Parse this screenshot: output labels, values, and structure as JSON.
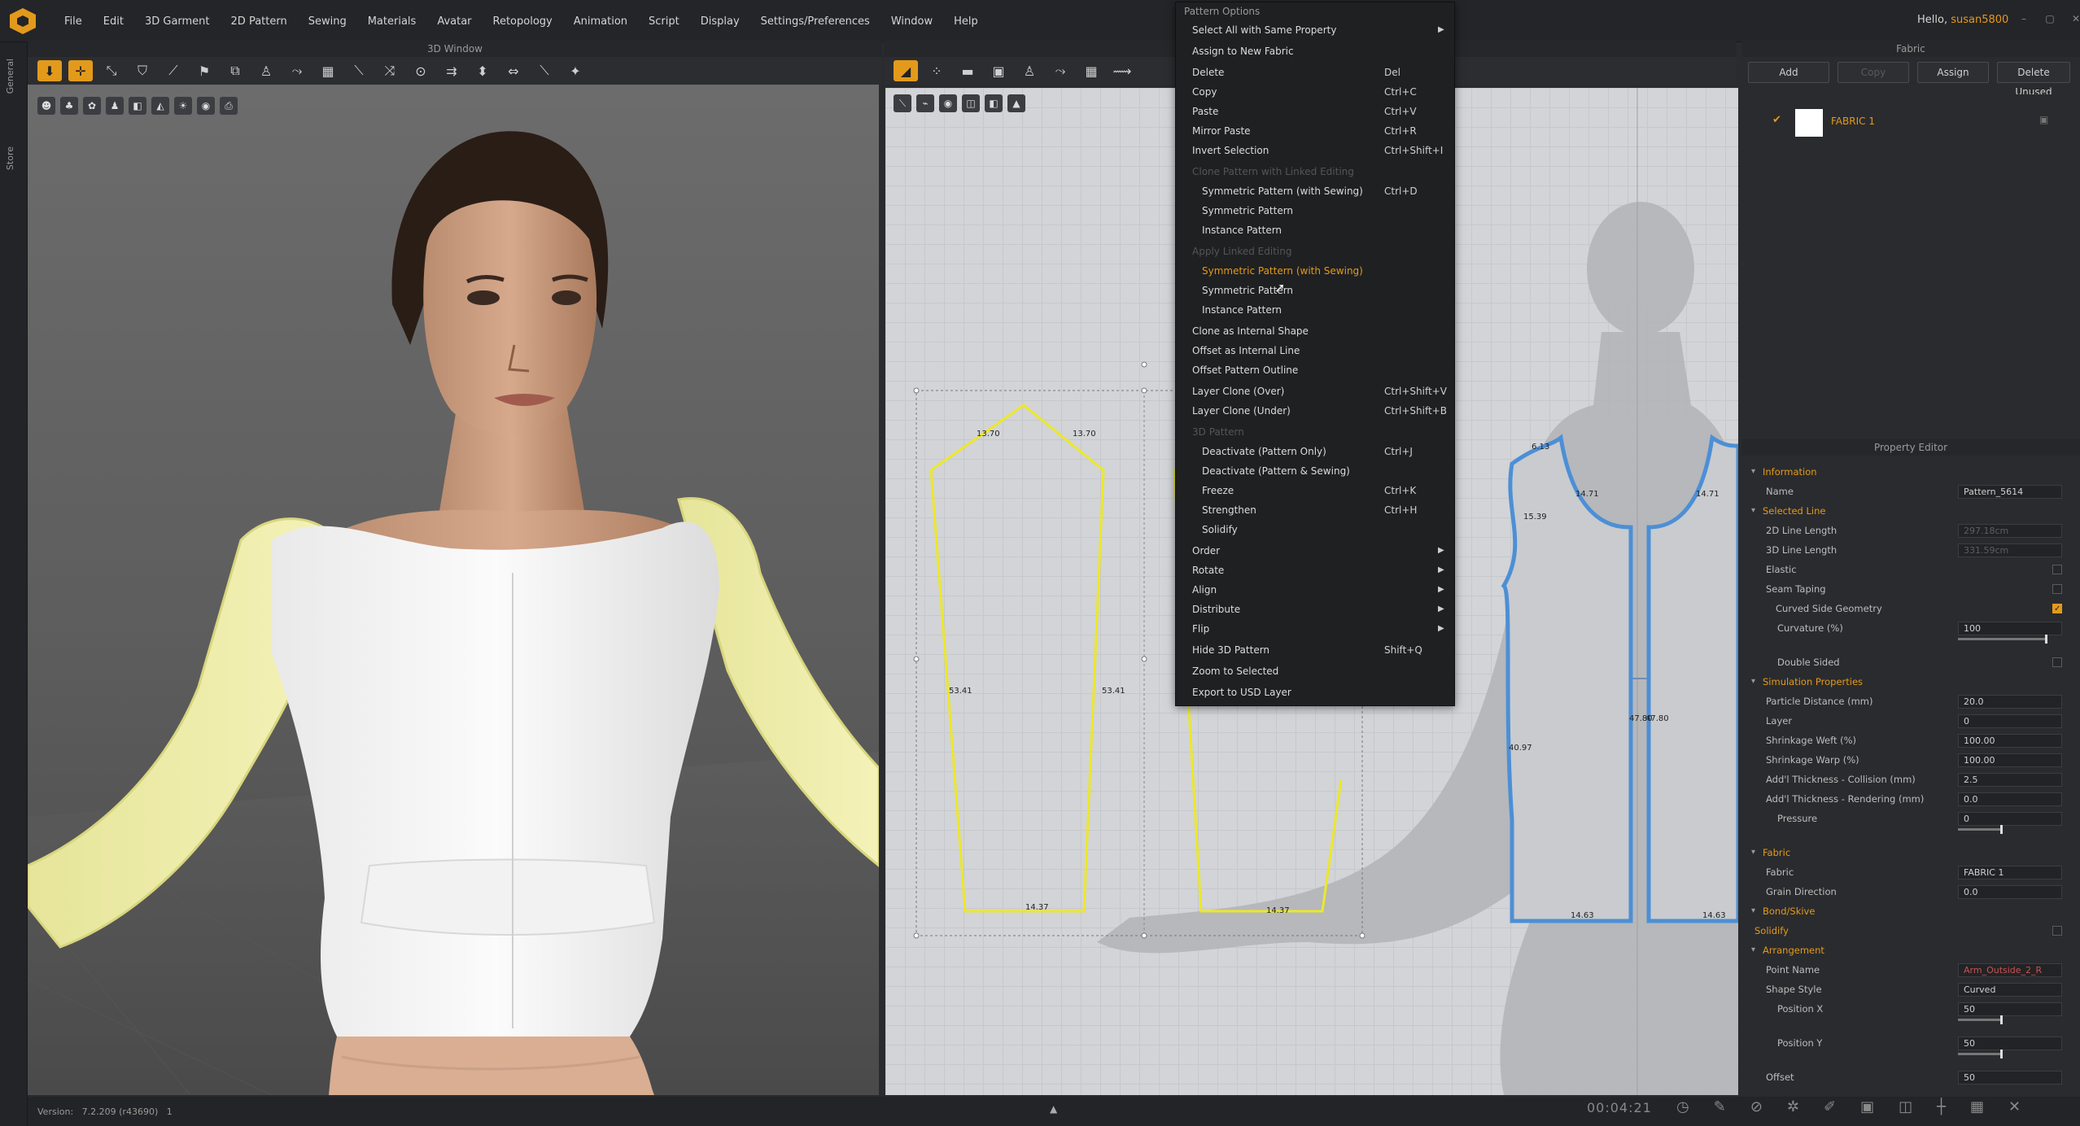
{
  "menubar": {
    "items": [
      "File",
      "Edit",
      "3D Garment",
      "2D Pattern",
      "Sewing",
      "Materials",
      "Avatar",
      "Retopology",
      "Animation",
      "Script",
      "Display",
      "Settings/Preferences",
      "Window",
      "Help"
    ],
    "greeting": "Hello,",
    "username": "susan5800"
  },
  "left_tabs": [
    "General",
    "Store"
  ],
  "window3d": {
    "title": "3D Window"
  },
  "fabric_panel": {
    "title": "Fabric",
    "buttons": {
      "add": "Add",
      "copy": "Copy",
      "assign": "Assign",
      "delete_unused": "Delete Unused"
    },
    "item": {
      "name": "FABRIC 1"
    }
  },
  "context_menu": {
    "title": "Pattern Options",
    "items": [
      {
        "label": "Select All with Same Property",
        "key": "",
        "submenu": true,
        "kind": "item"
      },
      {
        "label": "Assign to New Fabric",
        "key": "",
        "submenu": false,
        "kind": "item"
      },
      {
        "label": "Delete",
        "key": "Del",
        "submenu": false,
        "kind": "item"
      },
      {
        "label": "Copy",
        "key": "Ctrl+C",
        "submenu": false,
        "kind": "item"
      },
      {
        "label": "Paste",
        "key": "Ctrl+V",
        "submenu": false,
        "kind": "item"
      },
      {
        "label": "Mirror Paste",
        "key": "Ctrl+R",
        "submenu": false,
        "kind": "item"
      },
      {
        "label": "Invert Selection",
        "key": "Ctrl+Shift+I",
        "submenu": false,
        "kind": "item"
      },
      {
        "label": "Clone Pattern with Linked Editing",
        "key": "",
        "submenu": false,
        "kind": "header"
      },
      {
        "label": "Symmetric Pattern (with Sewing)",
        "key": "Ctrl+D",
        "submenu": false,
        "kind": "indent"
      },
      {
        "label": "Symmetric Pattern",
        "key": "",
        "submenu": false,
        "kind": "indent"
      },
      {
        "label": "Instance Pattern",
        "key": "",
        "submenu": false,
        "kind": "indent"
      },
      {
        "label": "Apply Linked Editing",
        "key": "",
        "submenu": false,
        "kind": "header"
      },
      {
        "label": "Symmetric Pattern (with Sewing)",
        "key": "",
        "submenu": false,
        "kind": "highlight"
      },
      {
        "label": "Symmetric Pattern",
        "key": "",
        "submenu": false,
        "kind": "indent"
      },
      {
        "label": "Instance Pattern",
        "key": "",
        "submenu": false,
        "kind": "indent"
      },
      {
        "label": "Clone as Internal Shape",
        "key": "",
        "submenu": false,
        "kind": "item"
      },
      {
        "label": "Offset as Internal Line",
        "key": "",
        "submenu": false,
        "kind": "item"
      },
      {
        "label": "Offset Pattern Outline",
        "key": "",
        "submenu": false,
        "kind": "item"
      },
      {
        "label": "Layer Clone (Over)",
        "key": "Ctrl+Shift+V",
        "submenu": false,
        "kind": "item"
      },
      {
        "label": "Layer Clone (Under)",
        "key": "Ctrl+Shift+B",
        "submenu": false,
        "kind": "item"
      },
      {
        "label": "3D Pattern",
        "key": "",
        "submenu": false,
        "kind": "header"
      },
      {
        "label": "Deactivate (Pattern Only)",
        "key": "Ctrl+J",
        "submenu": false,
        "kind": "indent"
      },
      {
        "label": "Deactivate (Pattern & Sewing)",
        "key": "",
        "submenu": false,
        "kind": "indent"
      },
      {
        "label": "Freeze",
        "key": "Ctrl+K",
        "submenu": false,
        "kind": "indent"
      },
      {
        "label": "Strengthen",
        "key": "Ctrl+H",
        "submenu": false,
        "kind": "indent"
      },
      {
        "label": "Solidify",
        "key": "",
        "submenu": false,
        "kind": "indent"
      },
      {
        "label": "Order",
        "key": "",
        "submenu": true,
        "kind": "item"
      },
      {
        "label": "Rotate",
        "key": "",
        "submenu": true,
        "kind": "item"
      },
      {
        "label": "Align",
        "key": "",
        "submenu": true,
        "kind": "item"
      },
      {
        "label": "Distribute",
        "key": "",
        "submenu": true,
        "kind": "item"
      },
      {
        "label": "Flip",
        "key": "",
        "submenu": true,
        "kind": "item"
      },
      {
        "label": "Hide 3D Pattern",
        "key": "Shift+Q",
        "submenu": false,
        "kind": "item"
      },
      {
        "label": "Zoom to Selected",
        "key": "",
        "submenu": false,
        "kind": "item"
      },
      {
        "label": "Export to USD Layer",
        "key": "",
        "submenu": false,
        "kind": "item"
      }
    ]
  },
  "pattern_measurements": {
    "left_top_a": "13.70",
    "left_top_b": "13.70",
    "left_side_a": "53.41",
    "left_side_b": "53.41",
    "left_bottom": "14.37",
    "mid_bottom": "14.37",
    "bodice_neck": "6.13",
    "bodice_shoulder_a": "14.71",
    "bodice_shoulder_b": "14.71",
    "bodice_armhole": "15.39",
    "bodice_side": "40.97",
    "bodice_center": "47.80",
    "bodice_center_b": "47.80",
    "bodice_hem_a": "14.63",
    "bodice_hem_b": "14.63"
  },
  "property_editor": {
    "title": "Property Editor",
    "rows": [
      {
        "type": "sec",
        "label": "Information"
      },
      {
        "type": "row",
        "label": "Name",
        "value": "Pattern_5614"
      },
      {
        "type": "sec",
        "label": "Selected Line"
      },
      {
        "type": "row",
        "label": "2D Line Length",
        "value": "297.18cm",
        "dim": true
      },
      {
        "type": "row",
        "label": "3D Line Length",
        "value": "331.59cm",
        "dim": true
      },
      {
        "type": "chk",
        "label": "Elastic",
        "checked": false
      },
      {
        "type": "chk",
        "label": "Seam Taping",
        "checked": false
      },
      {
        "type": "chksub",
        "label": "Curved Side Geometry",
        "checked": true
      },
      {
        "type": "slider",
        "label": "Curvature (%)",
        "value": "100",
        "level": 100
      },
      {
        "type": "chk2",
        "label": "Double Sided",
        "checked": false
      },
      {
        "type": "sec",
        "label": "Simulation Properties"
      },
      {
        "type": "row",
        "label": "Particle Distance (mm)",
        "value": "20.0"
      },
      {
        "type": "row",
        "label": "Layer",
        "value": "0"
      },
      {
        "type": "row",
        "label": "Shrinkage Weft (%)",
        "value": "100.00"
      },
      {
        "type": "row",
        "label": "Shrinkage Warp (%)",
        "value": "100.00"
      },
      {
        "type": "row",
        "label": "Add'l Thickness - Collision (mm)",
        "value": "2.5"
      },
      {
        "type": "row",
        "label": "Add'l Thickness - Rendering (mm)",
        "value": "0.0"
      },
      {
        "type": "slider",
        "label": "Pressure",
        "value": "0",
        "level": 50
      },
      {
        "type": "sec",
        "label": "Fabric"
      },
      {
        "type": "row",
        "label": "Fabric",
        "value": "FABRIC 1"
      },
      {
        "type": "row",
        "label": "Grain Direction",
        "value": "0.0"
      },
      {
        "type": "sec",
        "label": "Bond/Skive"
      },
      {
        "type": "chkhead",
        "label": "Solidify",
        "checked": false
      },
      {
        "type": "sec",
        "label": "Arrangement"
      },
      {
        "type": "row",
        "label": "Point Name",
        "value": "Arm_Outside_2_R",
        "red": true
      },
      {
        "type": "row",
        "label": "Shape Style",
        "value": "Curved"
      },
      {
        "type": "slider",
        "label": "Position X",
        "value": "50",
        "level": 50
      },
      {
        "type": "slider",
        "label": "Position Y",
        "value": "50",
        "level": 50
      },
      {
        "type": "row",
        "label": "Offset",
        "value": "50"
      }
    ]
  },
  "status": {
    "version_label": "Version:",
    "version": "7.2.209 (r43690)",
    "extra": "1",
    "timer": "00:04:21"
  }
}
